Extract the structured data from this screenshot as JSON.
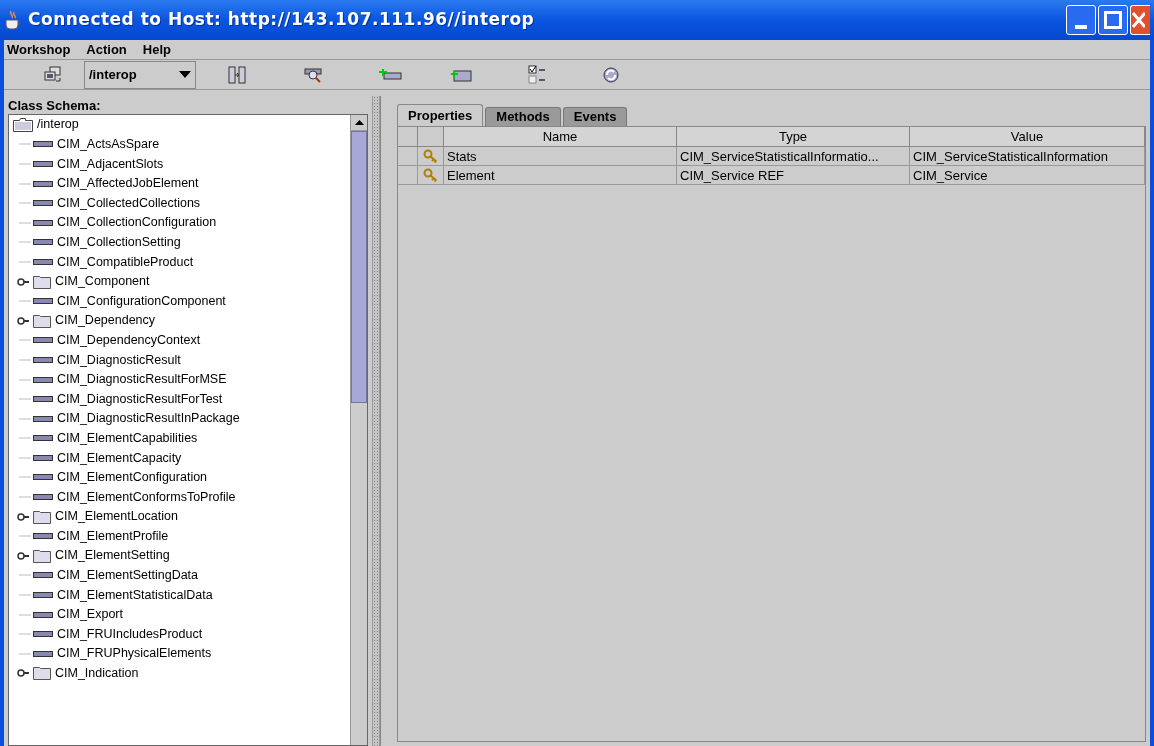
{
  "window": {
    "title": "Connected to Host: http://143.107.111.96//interop"
  },
  "menu": [
    "Workshop",
    "Action",
    "Help"
  ],
  "toolbar": {
    "namespace": "/interop"
  },
  "class_schema": {
    "label": "Class Schema:",
    "root": {
      "label": "/interop",
      "children": [
        {
          "label": "CIM_ActsAsSpare",
          "kind": "class"
        },
        {
          "label": "CIM_AdjacentSlots",
          "kind": "class"
        },
        {
          "label": "CIM_AffectedJobElement",
          "kind": "class"
        },
        {
          "label": "CIM_CollectedCollections",
          "kind": "class"
        },
        {
          "label": "CIM_CollectionConfiguration",
          "kind": "class"
        },
        {
          "label": "CIM_CollectionSetting",
          "kind": "class"
        },
        {
          "label": "CIM_CompatibleProduct",
          "kind": "class"
        },
        {
          "label": "CIM_Component",
          "kind": "folder",
          "expanded": false
        },
        {
          "label": "CIM_ConfigurationComponent",
          "kind": "class"
        },
        {
          "label": "CIM_Dependency",
          "kind": "folder",
          "expanded": false
        },
        {
          "label": "CIM_DependencyContext",
          "kind": "class"
        },
        {
          "label": "CIM_DiagnosticResult",
          "kind": "class"
        },
        {
          "label": "CIM_DiagnosticResultForMSE",
          "kind": "class"
        },
        {
          "label": "CIM_DiagnosticResultForTest",
          "kind": "class"
        },
        {
          "label": "CIM_DiagnosticResultInPackage",
          "kind": "class"
        },
        {
          "label": "CIM_ElementCapabilities",
          "kind": "class"
        },
        {
          "label": "CIM_ElementCapacity",
          "kind": "class"
        },
        {
          "label": "CIM_ElementConfiguration",
          "kind": "class"
        },
        {
          "label": "CIM_ElementConformsToProfile",
          "kind": "class"
        },
        {
          "label": "CIM_ElementLocation",
          "kind": "folder",
          "expanded": false
        },
        {
          "label": "CIM_ElementProfile",
          "kind": "class"
        },
        {
          "label": "CIM_ElementSetting",
          "kind": "folder",
          "expanded": false
        },
        {
          "label": "CIM_ElementSettingData",
          "kind": "class"
        },
        {
          "label": "CIM_ElementStatisticalData",
          "kind": "class"
        },
        {
          "label": "CIM_Export",
          "kind": "class"
        },
        {
          "label": "CIM_FRUIncludesProduct",
          "kind": "class"
        },
        {
          "label": "CIM_FRUPhysicalElements",
          "kind": "class"
        },
        {
          "label": "CIM_Indication",
          "kind": "folder",
          "expanded": false
        }
      ]
    }
  },
  "tabs": [
    {
      "label": "Properties",
      "selected": true
    },
    {
      "label": "Methods",
      "selected": false
    },
    {
      "label": "Events",
      "selected": false
    }
  ],
  "table": {
    "columns": [
      "Name",
      "Type",
      "Value"
    ],
    "rows": [
      {
        "name": "Stats",
        "type": "CIM_ServiceStatisticalInformatio...",
        "value": "CIM_ServiceStatisticalInformation",
        "key": true
      },
      {
        "name": "Element",
        "type": "CIM_Service REF",
        "value": "CIM_Service",
        "key": true
      }
    ]
  }
}
